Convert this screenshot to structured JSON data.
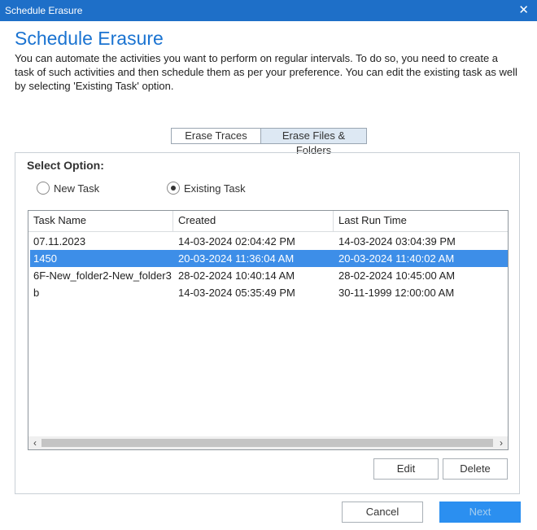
{
  "window": {
    "title": "Schedule Erasure",
    "close_glyph": "✕"
  },
  "heading": "Schedule Erasure",
  "description": "You can automate the activities you want to perform on regular intervals. To do so, you need to create a task of such activities and then schedule them as per your preference. You can edit the existing task as well by selecting 'Existing Task' option.",
  "tabs": [
    {
      "label": "Erase Traces",
      "active": false
    },
    {
      "label": "Erase Files & Folders",
      "active": true
    }
  ],
  "select_option": {
    "label": "Select Option:",
    "options": [
      {
        "label": "New Task",
        "selected": false
      },
      {
        "label": "Existing Task",
        "selected": true
      }
    ]
  },
  "table": {
    "columns": [
      "Task Name",
      "Created",
      "Last Run Time"
    ],
    "rows": [
      {
        "name": "07.11.2023",
        "created": "14-03-2024 02:04:42 PM",
        "last_run": "14-03-2024 03:04:39 PM",
        "selected": false
      },
      {
        "name": "1450",
        "created": "20-03-2024 11:36:04 AM",
        "last_run": "20-03-2024 11:40:02 AM",
        "selected": true
      },
      {
        "name": "6F-New_folder2-New_folder3",
        "created": "28-02-2024 10:40:14 AM",
        "last_run": "28-02-2024 10:45:00 AM",
        "selected": false
      },
      {
        "name": "b",
        "created": "14-03-2024 05:35:49 PM",
        "last_run": "30-11-1999 12:00:00 AM",
        "selected": false
      }
    ],
    "scroll_left_glyph": "‹",
    "scroll_right_glyph": "›"
  },
  "buttons": {
    "edit": "Edit",
    "delete": "Delete",
    "cancel": "Cancel",
    "next": "Next"
  },
  "colors": {
    "titlebar": "#1e6fc8",
    "heading": "#1a73d1",
    "selected_row": "#3d8ee8",
    "next_button": "#2b8ff0"
  }
}
